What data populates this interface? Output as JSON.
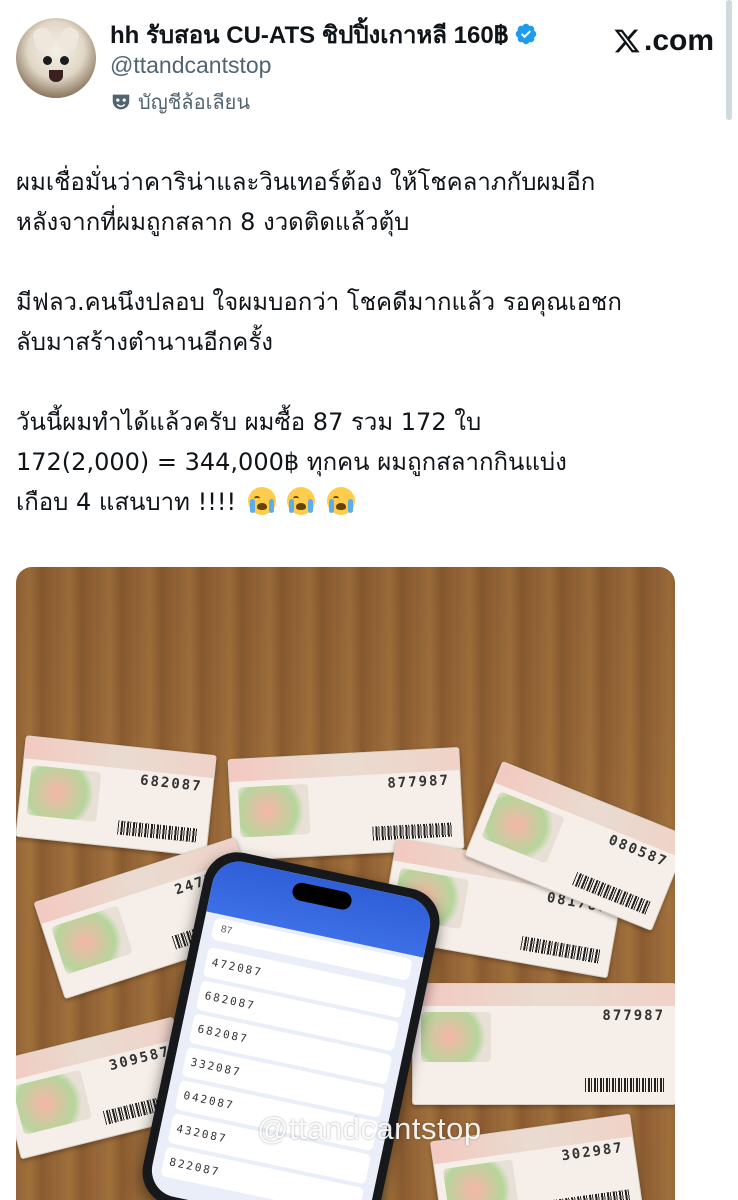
{
  "author": {
    "display_name": "hh รับสอน CU-ATS ชิปปิ้งเกาหลี 160฿",
    "handle": "@ttandcantstop",
    "parody_label": "บัญชีล้อเลียน"
  },
  "brand": {
    "site": ".com"
  },
  "post": {
    "p1_line1": "ผมเชื่อมั่นว่าคาริน่าและวินเทอร์ต้อง ให้โชคลาภกับผมอีก",
    "p1_line2": "หลังจากที่ผมถูกสลาก 8 งวดติดแล้วตุ้บ",
    "p2_line1": "มีฟลว.คนนึงปลอบ ใจผมบอกว่า โชคดีมากแล้ว รอคุณเอชก",
    "p2_line2": "ลับมาสร้างตำนานอีกครั้ง",
    "p3_line1": "วันนี้ผมทำได้แล้วครับ ผมซื้อ 87 รวม 172 ใบ",
    "p3_line2": "172(2,000) = 344,000฿ ทุกคน ผมถูกสลากกินแบ่ง",
    "p3_line3": "เกือบ 4 แสนบาท !!!!"
  },
  "photo": {
    "watermark": "@ttandcantstop",
    "tickets": [
      "682087",
      "877987",
      "247387",
      "081787",
      "080587",
      "877987",
      "309587",
      "302987"
    ],
    "phone_search": "87",
    "phone_rows": [
      "472087",
      "682087",
      "682087",
      "332087",
      "042087",
      "432087",
      "822087"
    ]
  },
  "colors": {
    "text_primary": "#0f1419",
    "text_secondary": "#536471",
    "verified_blue": "#1d9bf0"
  }
}
